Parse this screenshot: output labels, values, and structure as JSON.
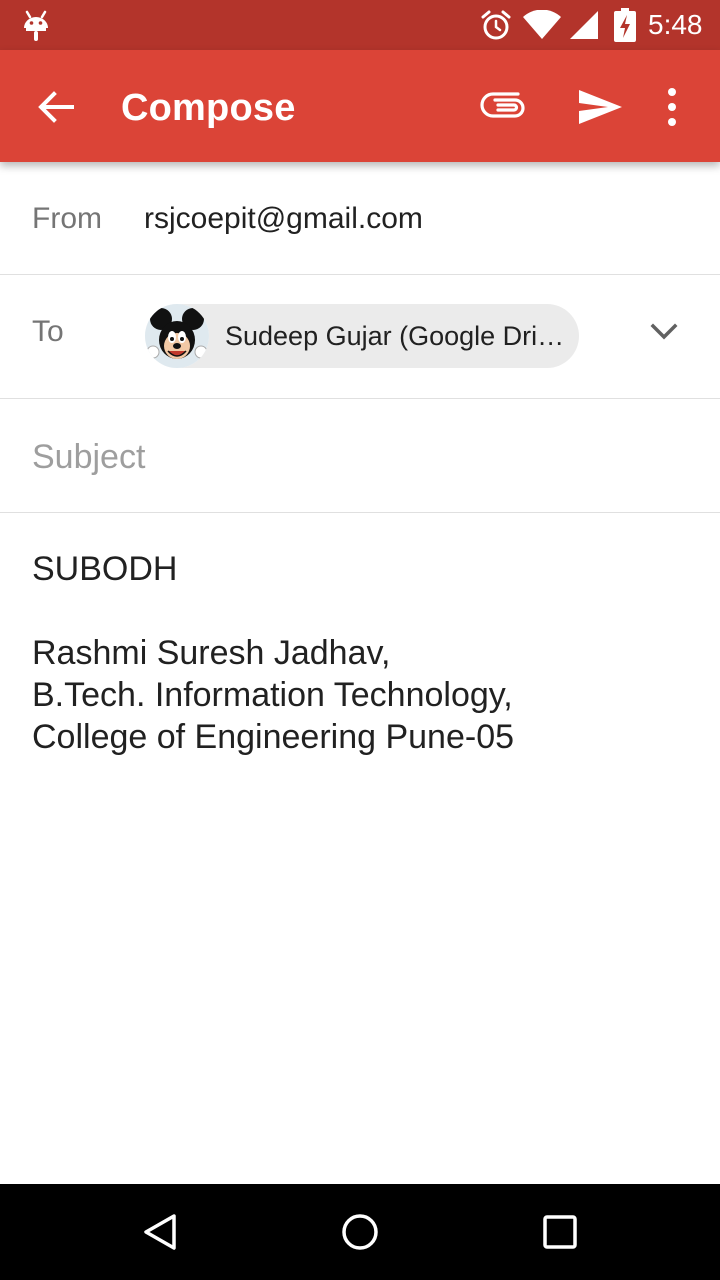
{
  "status_bar": {
    "time": "5:48",
    "icons": [
      "android-debug-icon",
      "alarm-icon",
      "wifi-icon",
      "signal-icon",
      "battery-charging-icon"
    ],
    "background": "#b3342b"
  },
  "app_bar": {
    "title": "Compose",
    "background": "#db4437",
    "actions": [
      "attach-icon",
      "send-icon",
      "more-vert-icon"
    ]
  },
  "compose": {
    "from_label": "From",
    "from_value": "rsjcoepit@gmail.com",
    "to_label": "To",
    "to_chip": "Sudeep Gujar (Google Dri…",
    "subject_placeholder": "Subject",
    "subject_value": "",
    "body": {
      "line1": "SUBODH",
      "line2": "Rashmi Suresh Jadhav,",
      "line3": "B.Tech. Information Technology,",
      "line4": "College of Engineering Pune-05"
    }
  },
  "nav_bar": {
    "buttons": [
      "back-icon",
      "home-icon",
      "recents-icon"
    ]
  }
}
